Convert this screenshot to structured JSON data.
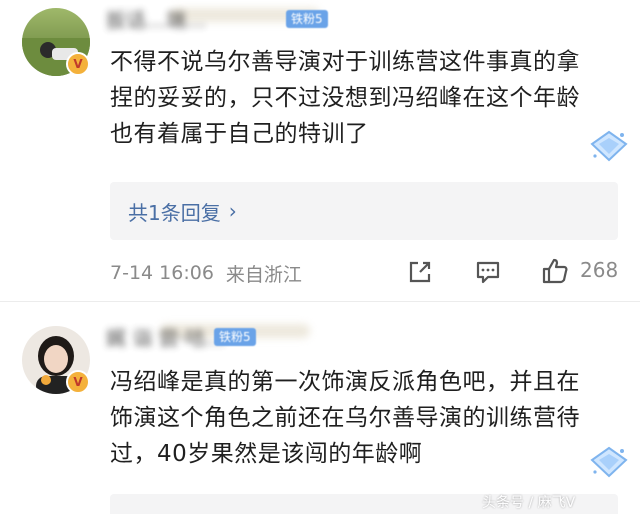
{
  "comments": [
    {
      "username": "扳话…端…",
      "fan_badge": "铁粉5",
      "text": "不得不说乌尔善导演对于训练营这件事真的拿捏的妥妥的，只不过没想到冯绍峰在这个年龄也有着属于自己的特训了",
      "replies_label": "共1条回复",
      "time": "7-14 16:06",
      "location": "来自浙江",
      "like_count": "268"
    },
    {
      "username": "娓 诣 尝·咕…",
      "fan_badge": "铁粉5",
      "text": "冯绍峰是真的第一次饰演反派角色吧，并且在饰演这个角色之前还在乌尔善导演的训练营待过，40岁果然是该闯的年龄啊"
    }
  ],
  "watermark": "头条号 / 麻飞V",
  "icons": {
    "verified": "v-badge-icon",
    "share": "share-icon",
    "comment": "comment-icon",
    "like": "thumbs-up-icon",
    "diamond": "diamond-icon",
    "chevron": "chevron-right-icon"
  },
  "colors": {
    "link": "#4a6fa5",
    "meta": "#8a8a8a",
    "verified_badge": "#f4b13b",
    "fan_badge": "#6aa3e8"
  }
}
